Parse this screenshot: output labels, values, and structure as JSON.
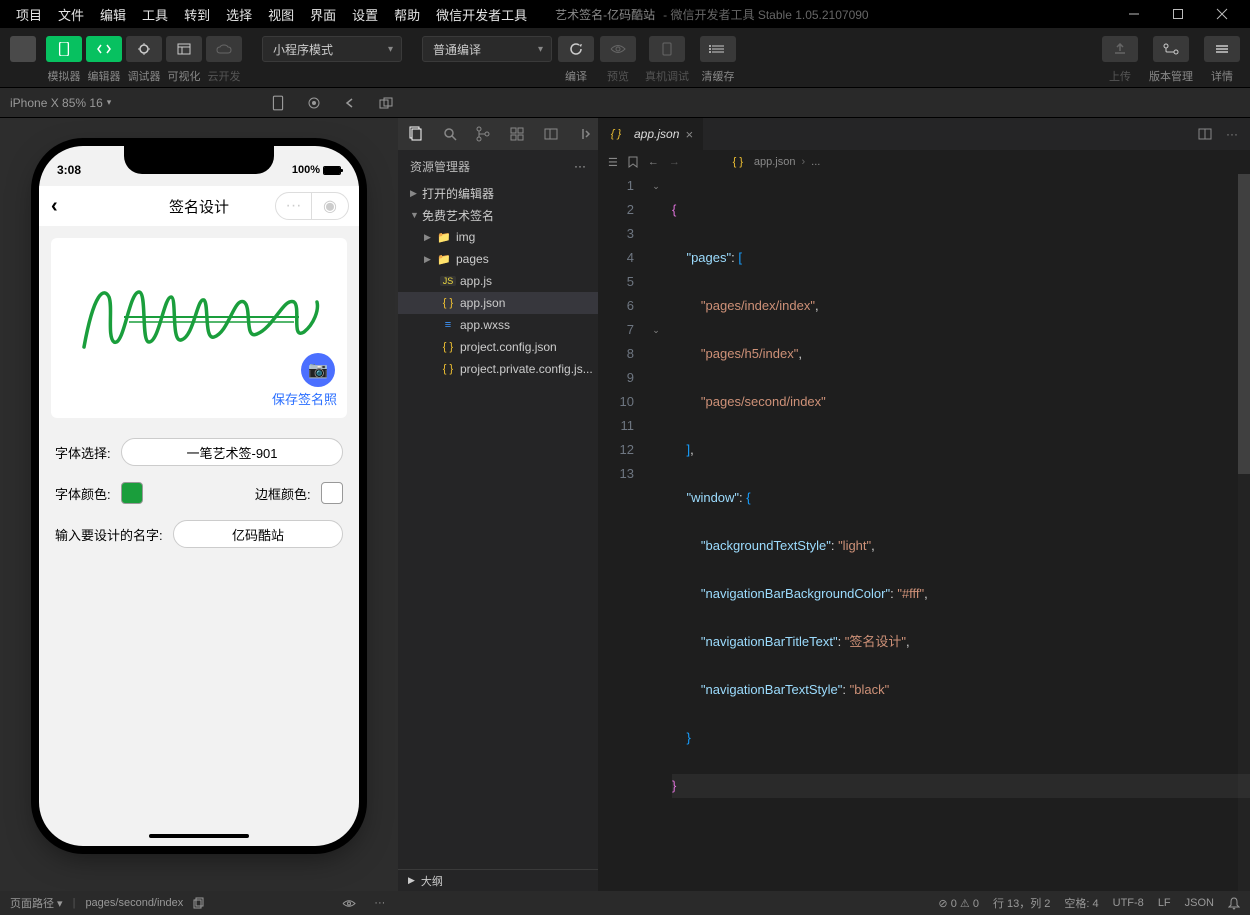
{
  "menu": [
    "项目",
    "文件",
    "编辑",
    "工具",
    "转到",
    "选择",
    "视图",
    "界面",
    "设置",
    "帮助",
    "微信开发者工具"
  ],
  "app_title": "艺术签名-亿码酷站",
  "app_subtitle": "- 微信开发者工具 Stable 1.05.2107090",
  "toolbar": {
    "labels": [
      "模拟器",
      "编辑器",
      "调试器",
      "可视化",
      "云开发"
    ],
    "mode": "小程序模式",
    "compile_mode": "普通编译",
    "right_labels": {
      "compile": "编译",
      "preview": "预览",
      "remote": "真机调试",
      "clear": "清缓存",
      "upload": "上传",
      "version": "版本管理",
      "detail": "详情"
    }
  },
  "device": {
    "name": "iPhone X 85% 16"
  },
  "phone": {
    "time": "3:08",
    "battery_pct": "100%",
    "nav_title": "签名设计",
    "save_text": "保存签名照",
    "font_label": "字体选择:",
    "font_value": "一笔艺术签-901",
    "font_color_label": "字体颜色:",
    "border_color_label": "边框颜色:",
    "name_label": "输入要设计的名字:",
    "name_value": "亿码酷站"
  },
  "explorer": {
    "title": "资源管理器",
    "sections": {
      "editors": "打开的编辑器",
      "project": "免费艺术签名",
      "outline": "大纲"
    },
    "tree": {
      "img": "img",
      "pages": "pages",
      "appjs": "app.js",
      "appjson": "app.json",
      "appwxss": "app.wxss",
      "projectconfig": "project.config.json",
      "projectprivate": "project.private.config.js..."
    }
  },
  "tab": {
    "name": "app.json"
  },
  "breadcrumb": {
    "file": "app.json",
    "more": "..."
  },
  "code": {
    "l1": "{",
    "l2_k": "\"pages\"",
    "l2_p": ": ",
    "l2_b": "[",
    "l3": "\"pages/index/index\"",
    "comma": ",",
    "l4": "\"pages/h5/index\"",
    "l5": "\"pages/second/index\"",
    "l6": "]",
    "l7_k": "\"window\"",
    "l7_p": ": ",
    "l7_b": "{",
    "l8_k": "\"backgroundTextStyle\"",
    "l8_v": "\"light\"",
    "l9_k": "\"navigationBarBackgroundColor\"",
    "l9_v": "\"#fff\"",
    "l10_k": "\"navigationBarTitleText\"",
    "l10_v": "\"签名设计\"",
    "l11_k": "\"navigationBarTextStyle\"",
    "l11_v": "\"black\"",
    "l12": "}",
    "l13": "}"
  },
  "status": {
    "page_path_label": "页面路径",
    "page_path": "pages/second/index",
    "errors": "0",
    "warnings": "0",
    "cursor": "行 13，列 2",
    "spaces": "空格: 4",
    "encoding": "UTF-8",
    "eol": "LF",
    "lang": "JSON"
  }
}
